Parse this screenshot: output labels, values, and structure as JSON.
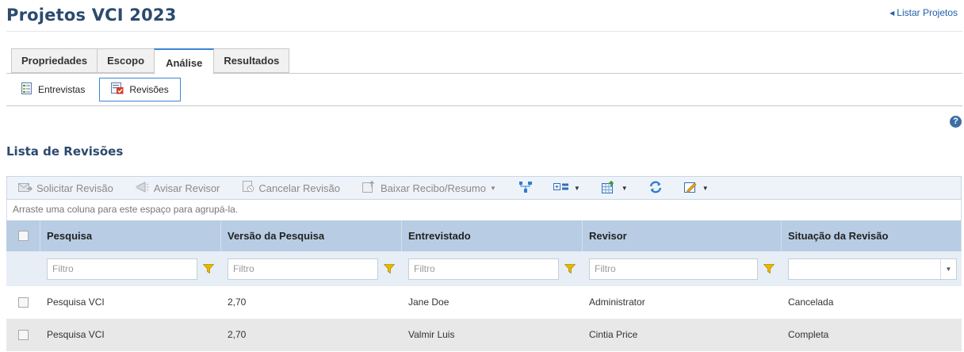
{
  "page": {
    "title": "Projetos VCI 2023",
    "back_link": "Listar Projetos"
  },
  "tabs": [
    {
      "label": "Propriedades",
      "active": false
    },
    {
      "label": "Escopo",
      "active": false
    },
    {
      "label": "Análise",
      "active": true
    },
    {
      "label": "Resultados",
      "active": false
    }
  ],
  "subnav": [
    {
      "label": "Entrevistas",
      "icon": "interviews-icon",
      "active": false
    },
    {
      "label": "Revisões",
      "icon": "reviews-icon",
      "active": true
    }
  ],
  "section_title": "Lista de Revisões",
  "toolbar": {
    "request_review": "Solicitar Revisão",
    "notify_reviewer": "Avisar Revisor",
    "cancel_review": "Cancelar Revisão",
    "download_receipt": "Baixar Recibo/Resumo"
  },
  "group_hint": "Arraste uma coluna para este espaço para agrupá-la.",
  "columns": [
    "Pesquisa",
    "Versão da Pesquisa",
    "Entrevistado",
    "Revisor",
    "Situação da Revisão"
  ],
  "filter_placeholder": "Filtro",
  "rows": [
    {
      "survey": "Pesquisa VCI",
      "version": "2,70",
      "interviewee": "Jane Doe",
      "reviewer": "Administrator",
      "status": "Cancelada"
    },
    {
      "survey": "Pesquisa VCI",
      "version": "2,70",
      "interviewee": "Valmir Luis",
      "reviewer": "Cintia Price",
      "status": "Completa"
    }
  ],
  "colors": {
    "title": "#2b4a6f",
    "link": "#1f5fa8",
    "active_tab_accent": "#3c86d6",
    "header_bg": "#b8cde4",
    "filter_bg": "#e8eef6",
    "toolbar_bg": "#eef3f9",
    "alt_row_bg": "#e8e8e8",
    "filter_icon": "#e8b800"
  }
}
